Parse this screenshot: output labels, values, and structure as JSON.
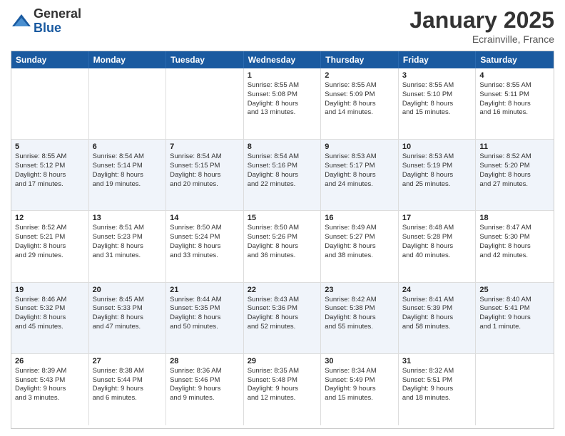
{
  "logo": {
    "general": "General",
    "blue": "Blue"
  },
  "title": "January 2025",
  "location": "Ecrainville, France",
  "days_of_week": [
    "Sunday",
    "Monday",
    "Tuesday",
    "Wednesday",
    "Thursday",
    "Friday",
    "Saturday"
  ],
  "weeks": [
    [
      {
        "num": "",
        "info": ""
      },
      {
        "num": "",
        "info": ""
      },
      {
        "num": "",
        "info": ""
      },
      {
        "num": "1",
        "info": "Sunrise: 8:55 AM\nSunset: 5:08 PM\nDaylight: 8 hours\nand 13 minutes."
      },
      {
        "num": "2",
        "info": "Sunrise: 8:55 AM\nSunset: 5:09 PM\nDaylight: 8 hours\nand 14 minutes."
      },
      {
        "num": "3",
        "info": "Sunrise: 8:55 AM\nSunset: 5:10 PM\nDaylight: 8 hours\nand 15 minutes."
      },
      {
        "num": "4",
        "info": "Sunrise: 8:55 AM\nSunset: 5:11 PM\nDaylight: 8 hours\nand 16 minutes."
      }
    ],
    [
      {
        "num": "5",
        "info": "Sunrise: 8:55 AM\nSunset: 5:12 PM\nDaylight: 8 hours\nand 17 minutes."
      },
      {
        "num": "6",
        "info": "Sunrise: 8:54 AM\nSunset: 5:14 PM\nDaylight: 8 hours\nand 19 minutes."
      },
      {
        "num": "7",
        "info": "Sunrise: 8:54 AM\nSunset: 5:15 PM\nDaylight: 8 hours\nand 20 minutes."
      },
      {
        "num": "8",
        "info": "Sunrise: 8:54 AM\nSunset: 5:16 PM\nDaylight: 8 hours\nand 22 minutes."
      },
      {
        "num": "9",
        "info": "Sunrise: 8:53 AM\nSunset: 5:17 PM\nDaylight: 8 hours\nand 24 minutes."
      },
      {
        "num": "10",
        "info": "Sunrise: 8:53 AM\nSunset: 5:19 PM\nDaylight: 8 hours\nand 25 minutes."
      },
      {
        "num": "11",
        "info": "Sunrise: 8:52 AM\nSunset: 5:20 PM\nDaylight: 8 hours\nand 27 minutes."
      }
    ],
    [
      {
        "num": "12",
        "info": "Sunrise: 8:52 AM\nSunset: 5:21 PM\nDaylight: 8 hours\nand 29 minutes."
      },
      {
        "num": "13",
        "info": "Sunrise: 8:51 AM\nSunset: 5:23 PM\nDaylight: 8 hours\nand 31 minutes."
      },
      {
        "num": "14",
        "info": "Sunrise: 8:50 AM\nSunset: 5:24 PM\nDaylight: 8 hours\nand 33 minutes."
      },
      {
        "num": "15",
        "info": "Sunrise: 8:50 AM\nSunset: 5:26 PM\nDaylight: 8 hours\nand 36 minutes."
      },
      {
        "num": "16",
        "info": "Sunrise: 8:49 AM\nSunset: 5:27 PM\nDaylight: 8 hours\nand 38 minutes."
      },
      {
        "num": "17",
        "info": "Sunrise: 8:48 AM\nSunset: 5:28 PM\nDaylight: 8 hours\nand 40 minutes."
      },
      {
        "num": "18",
        "info": "Sunrise: 8:47 AM\nSunset: 5:30 PM\nDaylight: 8 hours\nand 42 minutes."
      }
    ],
    [
      {
        "num": "19",
        "info": "Sunrise: 8:46 AM\nSunset: 5:32 PM\nDaylight: 8 hours\nand 45 minutes."
      },
      {
        "num": "20",
        "info": "Sunrise: 8:45 AM\nSunset: 5:33 PM\nDaylight: 8 hours\nand 47 minutes."
      },
      {
        "num": "21",
        "info": "Sunrise: 8:44 AM\nSunset: 5:35 PM\nDaylight: 8 hours\nand 50 minutes."
      },
      {
        "num": "22",
        "info": "Sunrise: 8:43 AM\nSunset: 5:36 PM\nDaylight: 8 hours\nand 52 minutes."
      },
      {
        "num": "23",
        "info": "Sunrise: 8:42 AM\nSunset: 5:38 PM\nDaylight: 8 hours\nand 55 minutes."
      },
      {
        "num": "24",
        "info": "Sunrise: 8:41 AM\nSunset: 5:39 PM\nDaylight: 8 hours\nand 58 minutes."
      },
      {
        "num": "25",
        "info": "Sunrise: 8:40 AM\nSunset: 5:41 PM\nDaylight: 9 hours\nand 1 minute."
      }
    ],
    [
      {
        "num": "26",
        "info": "Sunrise: 8:39 AM\nSunset: 5:43 PM\nDaylight: 9 hours\nand 3 minutes."
      },
      {
        "num": "27",
        "info": "Sunrise: 8:38 AM\nSunset: 5:44 PM\nDaylight: 9 hours\nand 6 minutes."
      },
      {
        "num": "28",
        "info": "Sunrise: 8:36 AM\nSunset: 5:46 PM\nDaylight: 9 hours\nand 9 minutes."
      },
      {
        "num": "29",
        "info": "Sunrise: 8:35 AM\nSunset: 5:48 PM\nDaylight: 9 hours\nand 12 minutes."
      },
      {
        "num": "30",
        "info": "Sunrise: 8:34 AM\nSunset: 5:49 PM\nDaylight: 9 hours\nand 15 minutes."
      },
      {
        "num": "31",
        "info": "Sunrise: 8:32 AM\nSunset: 5:51 PM\nDaylight: 9 hours\nand 18 minutes."
      },
      {
        "num": "",
        "info": ""
      }
    ]
  ]
}
